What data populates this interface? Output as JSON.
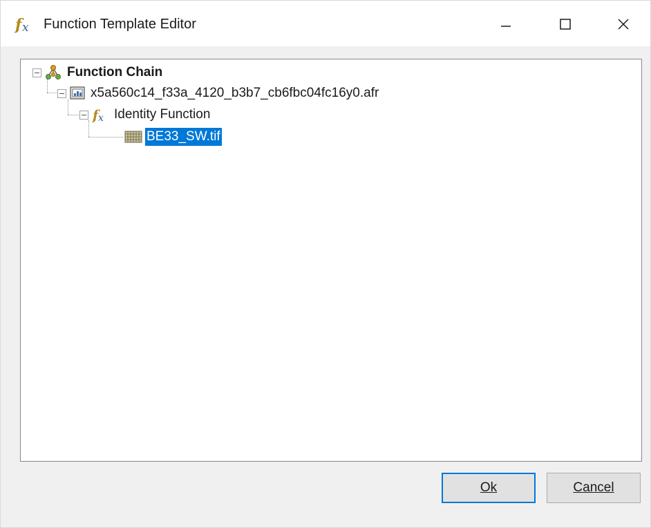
{
  "window": {
    "title": "Function Template Editor"
  },
  "tree": {
    "root": {
      "label": "Function Chain"
    },
    "file": {
      "label": "x5a560c14_f33a_4120_b3b7_cb6fbc04fc16y0.afr"
    },
    "function": {
      "label": "Identity Function"
    },
    "leaf": {
      "label": "BE33_SW.tif",
      "selected": true
    }
  },
  "buttons": {
    "ok": "Ok",
    "cancel": "Cancel"
  },
  "colors": {
    "selection": "#0078d7",
    "accent": "#0078d7"
  }
}
